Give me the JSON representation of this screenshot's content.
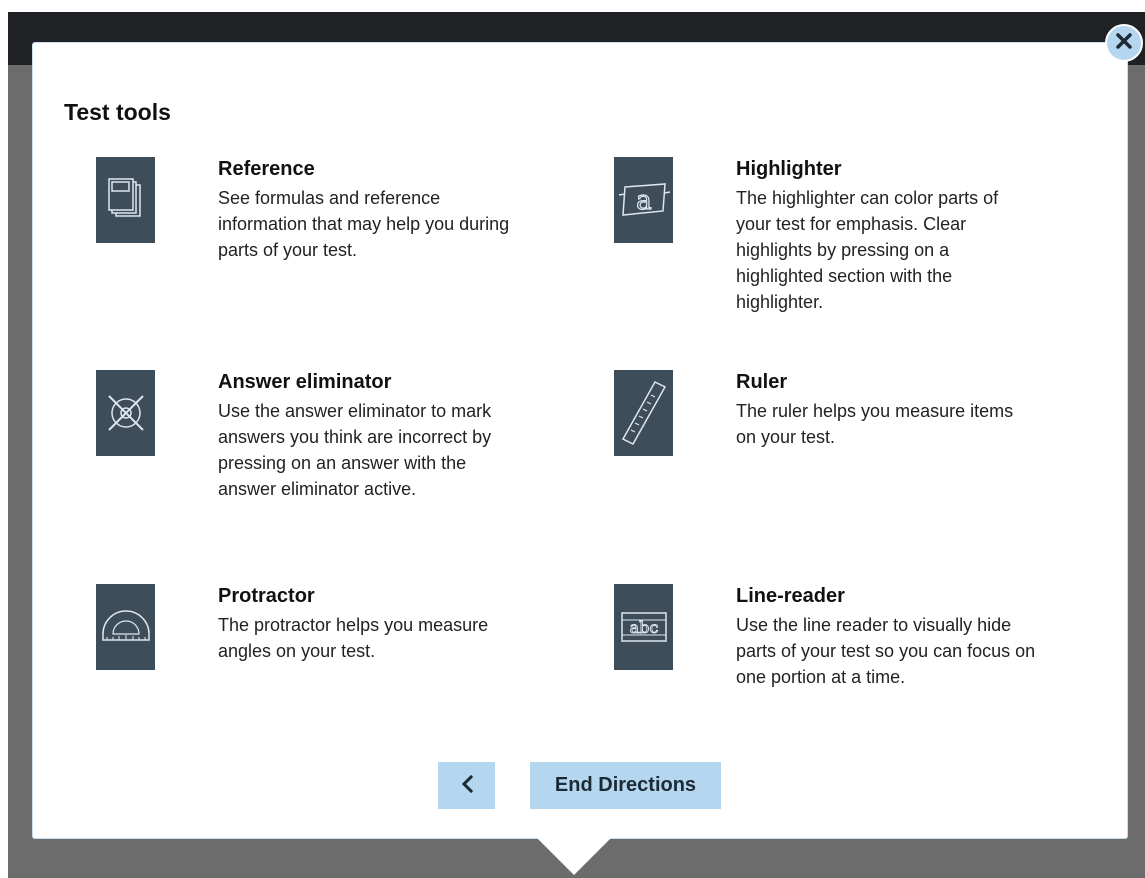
{
  "dialog": {
    "title": "Test tools",
    "close_icon": "close-icon",
    "tools": [
      {
        "name": "Reference",
        "icon": "reference-book-icon",
        "description": "See formulas and reference information that may help you during parts of your test."
      },
      {
        "name": "Highlighter",
        "icon": "highlighter-icon",
        "description": "The highlighter can color parts of your test for emphasis. Clear highlights by pressing on a highlighted section with the highlighter."
      },
      {
        "name": "Answer eliminator",
        "icon": "answer-eliminator-icon",
        "description": "Use the answer eliminator to mark answers you think are incorrect by pressing on an answer with the answer eliminator active."
      },
      {
        "name": "Ruler",
        "icon": "ruler-icon",
        "description": "The ruler helps you measure items on your test."
      },
      {
        "name": "Protractor",
        "icon": "protractor-icon",
        "description": "The protractor helps you measure angles on your test."
      },
      {
        "name": "Line-reader",
        "icon": "line-reader-icon",
        "description": "Use the line reader to visually hide parts of your test so you can focus on one portion at a time."
      }
    ],
    "back_icon": "chevron-left-icon",
    "end_label": "End Directions"
  },
  "colors": {
    "accent": "#b4d6ee",
    "icon_bg": "#3d4d5a",
    "header_bar": "#1f2125",
    "backdrop": "#6c6c6c"
  }
}
